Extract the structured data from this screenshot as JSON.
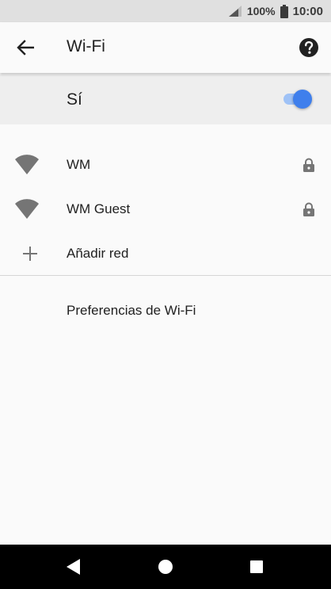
{
  "status_bar": {
    "battery": "100%",
    "time": "10:00"
  },
  "app_bar": {
    "title": "Wi-Fi"
  },
  "master_switch": {
    "label": "Sí",
    "state": "on"
  },
  "networks": [
    {
      "ssid": "WM",
      "secured": true,
      "icon": "wifi-signal-icon"
    },
    {
      "ssid": "WM Guest",
      "secured": true,
      "icon": "wifi-signal-icon"
    }
  ],
  "add_network": {
    "label": "Añadir red",
    "icon": "plus-icon"
  },
  "preferences": {
    "label": "Preferencias de Wi-Fi"
  },
  "colors": {
    "accent": "#3f7fec",
    "toggle_track": "#9fc2f6",
    "icon_grey": "#757575"
  }
}
